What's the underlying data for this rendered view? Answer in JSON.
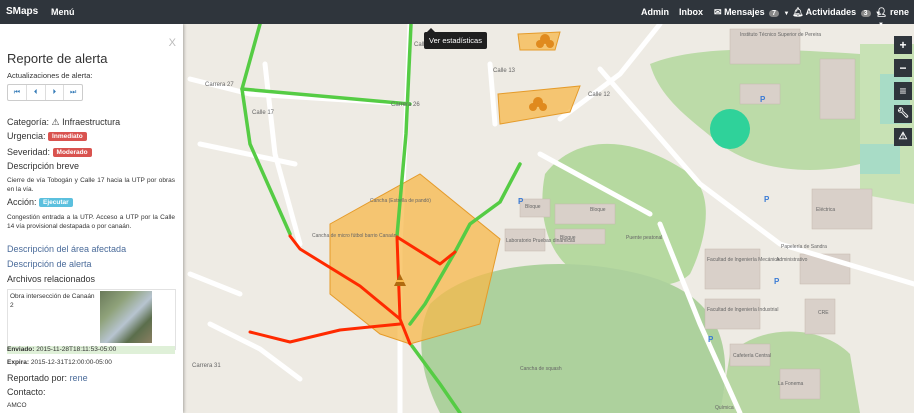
{
  "nav": {
    "brand": "SMaps",
    "menu": "Menú",
    "admin": "Admin",
    "inbox": "Inbox",
    "messages": "Mensajes",
    "messages_count": "7",
    "activities": "Actividades",
    "activities_count": "3",
    "user": "rene"
  },
  "panel": {
    "close": "X",
    "title": "Reporte de alerta",
    "updates_label": "Actualizaciones de alerta:",
    "pager": [
      "⏮",
      "⏴",
      "⏵",
      "⏭"
    ],
    "category_label": "Categoría:",
    "category_value": "Infraestructura",
    "urgency_label": "Urgencia:",
    "urgency_value": "Inmediato",
    "severity_label": "Severidad:",
    "severity_value": "Moderado",
    "brief_label": "Descripción breve",
    "brief_text": "Cierre de vía Tobogán y Calle 17 hacia la UTP por obras en la vía.",
    "action_label": "Acción:",
    "action_value": "Ejecutar",
    "action_text": "Congestión entrada a la UTP. Acceso a UTP por la Calle 14 vía provisional destapada o por canaán.",
    "area_desc_link": "Descripción del área afectada",
    "alert_desc_link": "Descripción de alerta",
    "files_label": "Archivos relacionados",
    "file_name": "Obra intersección de Canaán 2",
    "sent_label": "Enviado:",
    "sent_value": "2015-11-28T18:11:53-05:00",
    "expires_label": "Expira:",
    "expires_value": "2015-12-31T12:00:00-05:00",
    "reported_label": "Reportado por:",
    "reported_value": "rene",
    "contact_label": "Contacto:",
    "contact_value": "AMCO"
  },
  "tooltip": "Ver estadísticas",
  "tools": [
    "+",
    "−",
    "≡",
    "wrench",
    "warning"
  ],
  "map_labels": {
    "carrera27": "Carrera 27",
    "carrera26": "Carrera 26",
    "carrera31": "Carrera 31",
    "calle17": "Calle 17",
    "calle14": "Calle 14",
    "calle13": "Calle 13",
    "calle12": "Calle 12",
    "cancha1": "Cancha de micro fútbol barrio Canaán",
    "cancha2": "Cancha (Estrella de pandó)",
    "cancha3": "Cancha de squash",
    "instituto": "Instituto Técnico Superior de Pereira",
    "laboratorio": "Laboratorio Pruebas dinámicas",
    "bloque": "Bloque",
    "puente": "Puente peatonal",
    "electrica": "Eléctrica",
    "ing_mecanica": "Facultad de Ingeniería Mecánica",
    "ing_industrial": "Facultad de Ingeniería Industrial",
    "cafeteria": "Cafetería Central",
    "cre": "CRE",
    "administrativo": "Administrativo",
    "papeleria": "Papelería de Sandra",
    "quimica": "Química",
    "fonema": "La Fonema"
  },
  "colors": {
    "navbar": "#2f353c",
    "congested": "#ff2a00",
    "free_flow": "#55cc44",
    "area_fill": "#f7b84b",
    "area_stroke": "#e59b2a"
  }
}
